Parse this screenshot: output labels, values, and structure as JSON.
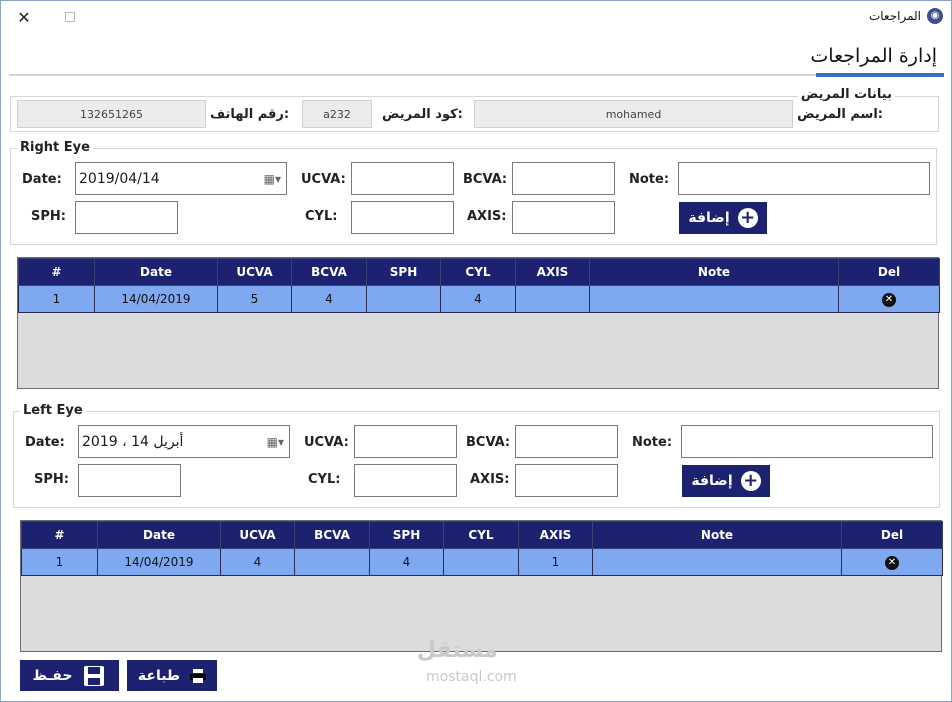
{
  "window": {
    "title": "المراجعات",
    "close_icon": "close-icon",
    "maximize_icon": "maximize-icon"
  },
  "page": {
    "tab_title": "إدارة المراجعات"
  },
  "patient": {
    "group_label": "بيانات المريض",
    "name_label": "اسم المريض:",
    "name_value": "mohamed",
    "code_label": "كود المريض:",
    "code_value": "a232",
    "phone_label": "رقم الهاتف:",
    "phone_value": "132651265"
  },
  "right_eye": {
    "group_label": "Right Eye",
    "date_label": "Date:",
    "date_value": "2019/04/14",
    "ucva_label": "UCVA:",
    "bcva_label": "BCVA:",
    "note_label": "Note:",
    "sph_label": "SPH:",
    "cyl_label": "CYL:",
    "axis_label": "AXIS:",
    "add_label": "إضافة"
  },
  "right_grid": {
    "columns": [
      "#",
      "Date",
      "UCVA",
      "BCVA",
      "SPH",
      "CYL",
      "AXIS",
      "Note",
      "Del"
    ],
    "rows": [
      [
        "1",
        "14/04/2019",
        "5",
        "4",
        "",
        "4",
        "",
        "",
        ""
      ]
    ]
  },
  "left_eye": {
    "group_label": "Left Eye",
    "date_label": "Date:",
    "date_value": "2019 ،  أبريل     14",
    "ucva_label": "UCVA:",
    "bcva_label": "BCVA:",
    "note_label": "Note:",
    "sph_label": "SPH:",
    "cyl_label": "CYL:",
    "axis_label": "AXIS:",
    "add_label": "إضافة"
  },
  "left_grid": {
    "columns": [
      "#",
      "Date",
      "UCVA",
      "BCVA",
      "SPH",
      "CYL",
      "AXIS",
      "Note",
      "Del"
    ],
    "rows": [
      [
        "1",
        "14/04/2019",
        "4",
        "",
        "4",
        "",
        "1",
        "",
        ""
      ]
    ]
  },
  "footer": {
    "save_label": "حفـظ",
    "print_label": "طباعة"
  },
  "watermark": {
    "brand": "مستقل",
    "site": "mostaql.com"
  },
  "colors": {
    "header_navy": "#1d2270",
    "row_blue": "#7ea8f0",
    "tab_accent": "#3a6fc4"
  }
}
